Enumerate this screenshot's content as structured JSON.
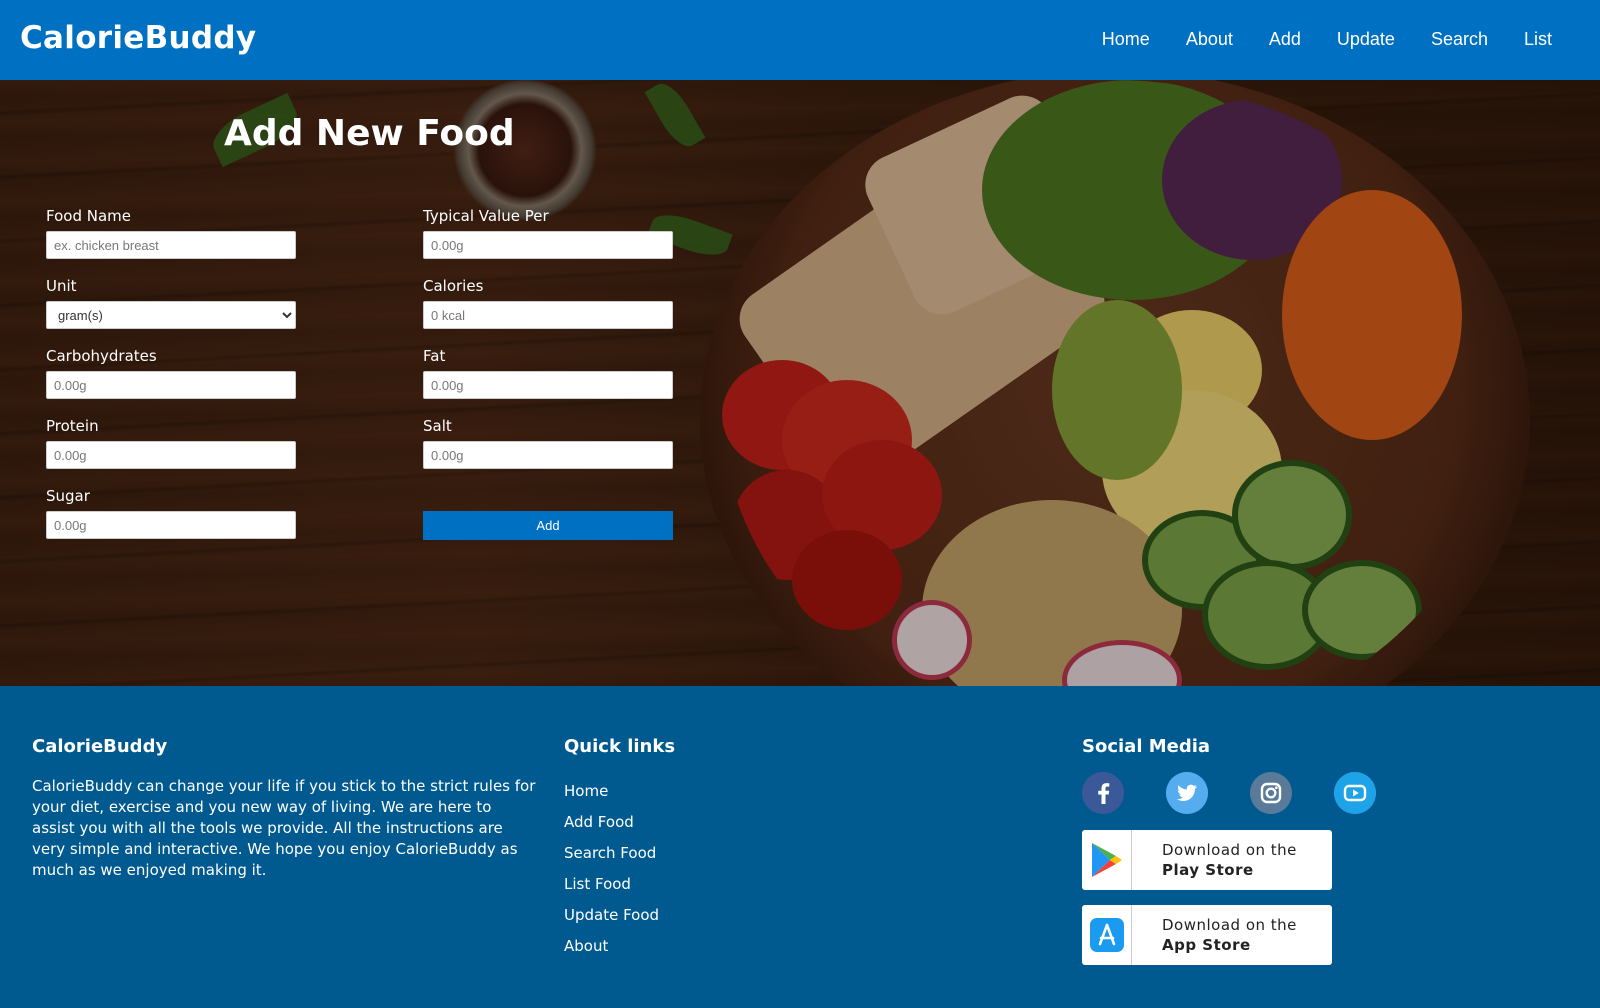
{
  "brand": "CalorieBuddy",
  "nav": [
    "Home",
    "About",
    "Add",
    "Update",
    "Search",
    "List"
  ],
  "form": {
    "title": "Add New Food",
    "fields": {
      "food_name": {
        "label": "Food Name",
        "placeholder": "ex. chicken breast"
      },
      "typical_value": {
        "label": "Typical Value Per",
        "placeholder": "0.00g"
      },
      "unit": {
        "label": "Unit",
        "selected": "gram(s)"
      },
      "calories": {
        "label": "Calories",
        "placeholder": "0 kcal"
      },
      "carbohydrates": {
        "label": "Carbohydrates",
        "placeholder": "0.00g"
      },
      "fat": {
        "label": "Fat",
        "placeholder": "0.00g"
      },
      "protein": {
        "label": "Protein",
        "placeholder": "0.00g"
      },
      "salt": {
        "label": "Salt",
        "placeholder": "0.00g"
      },
      "sugar": {
        "label": "Sugar",
        "placeholder": "0.00g"
      }
    },
    "submit_label": "Add"
  },
  "footer": {
    "about": {
      "title": "CalorieBuddy",
      "text": "CalorieBuddy can change your life if you stick to the strict rules for your diet, exercise and you new way of living. We are here to assist you with all the tools we provide. All the instructions are very simple and interactive. We hope you enjoy CalorieBuddy as much as we enjoyed making it."
    },
    "quick_links": {
      "title": "Quick links",
      "items": [
        "Home",
        "Add Food",
        "Search Food",
        "List Food",
        "Update Food",
        "About"
      ]
    },
    "social": {
      "title": "Social Media",
      "icons": [
        "facebook-icon",
        "twitter-icon",
        "instagram-icon",
        "youtube-icon"
      ],
      "play_store": {
        "line1": "Download on the",
        "line2": "Play Store"
      },
      "app_store": {
        "line1": "Download on the",
        "line2": "App Store"
      }
    }
  },
  "colors": {
    "primary": "#0070c2",
    "footer": "#005a8f"
  }
}
